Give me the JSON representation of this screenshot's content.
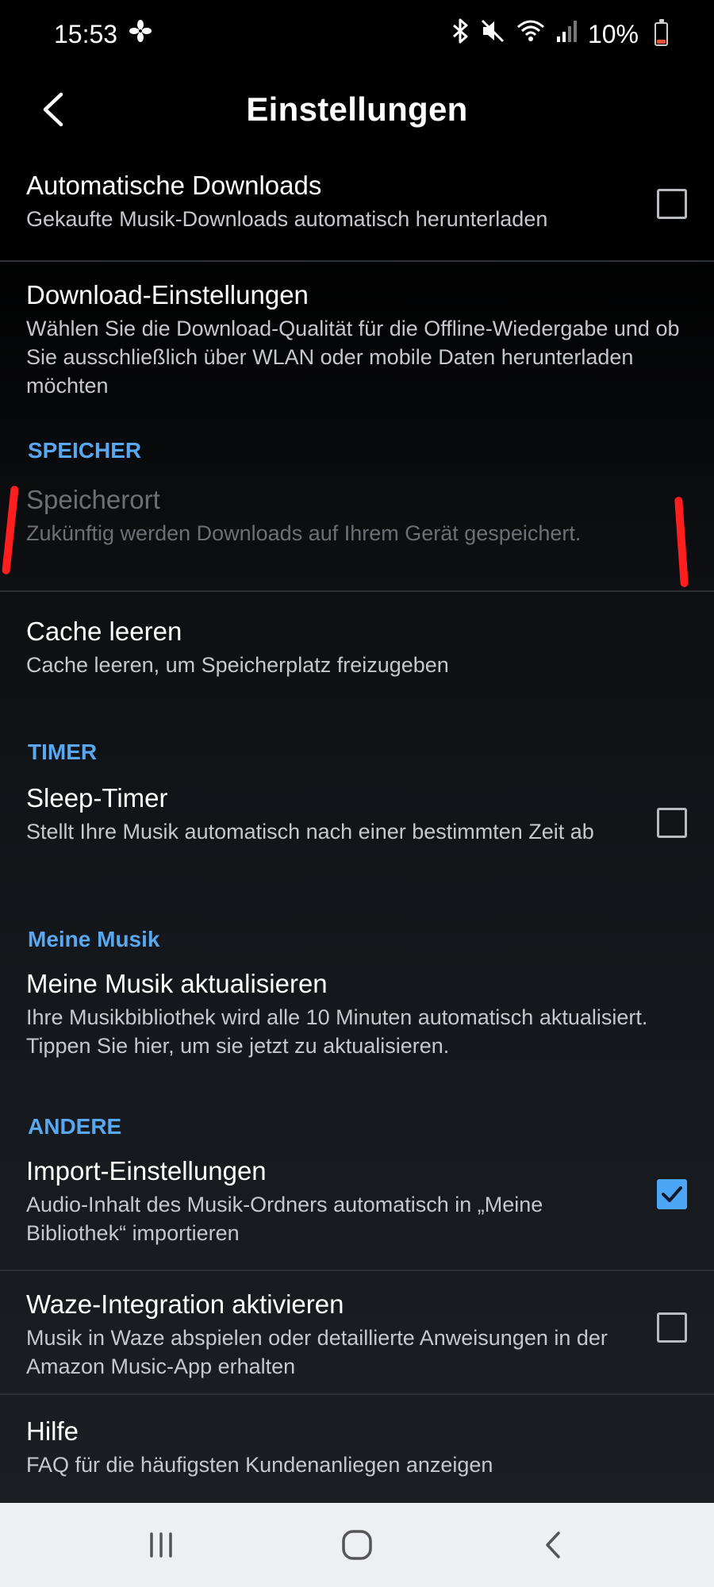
{
  "status_bar": {
    "time": "15:53",
    "battery_text": "10%",
    "icons": [
      "fan-icon",
      "bluetooth-icon",
      "mute-icon",
      "wifi-icon",
      "signal-icon",
      "battery-icon"
    ]
  },
  "app_bar": {
    "title": "Einstellungen",
    "back_icon": "chevron-left-icon"
  },
  "settings": {
    "auto_downloads": {
      "title": "Automatische Downloads",
      "subtitle": "Gekaufte Musik-Downloads automatisch herunterladen",
      "checked": false
    },
    "download_settings": {
      "title": "Download-Einstellungen",
      "subtitle": "Wählen Sie die Download-Qualität für die Offline-Wiedergabe und ob Sie ausschließlich über WLAN oder mobile Daten herunterladen möchten"
    },
    "section_storage": "SPEICHER",
    "storage_location": {
      "title": "Speicherort",
      "subtitle": "Zukünftig werden Downloads auf Ihrem Gerät gespeichert.",
      "disabled": true
    },
    "clear_cache": {
      "title": "Cache leeren",
      "subtitle": "Cache leeren, um Speicherplatz freizugeben"
    },
    "section_timer": "TIMER",
    "sleep_timer": {
      "title": "Sleep-Timer",
      "subtitle": "Stellt Ihre Musik automatisch nach einer bestimmten Zeit ab",
      "checked": false
    },
    "section_my_music": "Meine Musik",
    "refresh_my_music": {
      "title": "Meine Musik aktualisieren",
      "subtitle": "Ihre Musikbibliothek wird alle 10 Minuten automatisch aktualisiert. Tippen Sie hier, um sie jetzt zu aktualisieren."
    },
    "section_other": "ANDERE",
    "import_settings": {
      "title": "Import-Einstellungen",
      "subtitle": "Audio-Inhalt des Musik-Ordners automatisch in „Meine Bibliothek“ importieren",
      "checked": true
    },
    "waze": {
      "title": "Waze-Integration aktivieren",
      "subtitle": "Musik in Waze abspielen oder detaillierte Anweisungen in der Amazon Music-App erhalten",
      "checked": false
    },
    "help": {
      "title": "Hilfe",
      "subtitle": "FAQ für die häufigsten Kundenanliegen anzeigen"
    }
  },
  "nav_bar": {
    "icons": [
      "recent-apps-icon",
      "home-icon",
      "back-icon"
    ]
  },
  "colors": {
    "accent": "#4da6f5",
    "section_header": "#58a7ef",
    "annotation": "#ff1e1e"
  }
}
